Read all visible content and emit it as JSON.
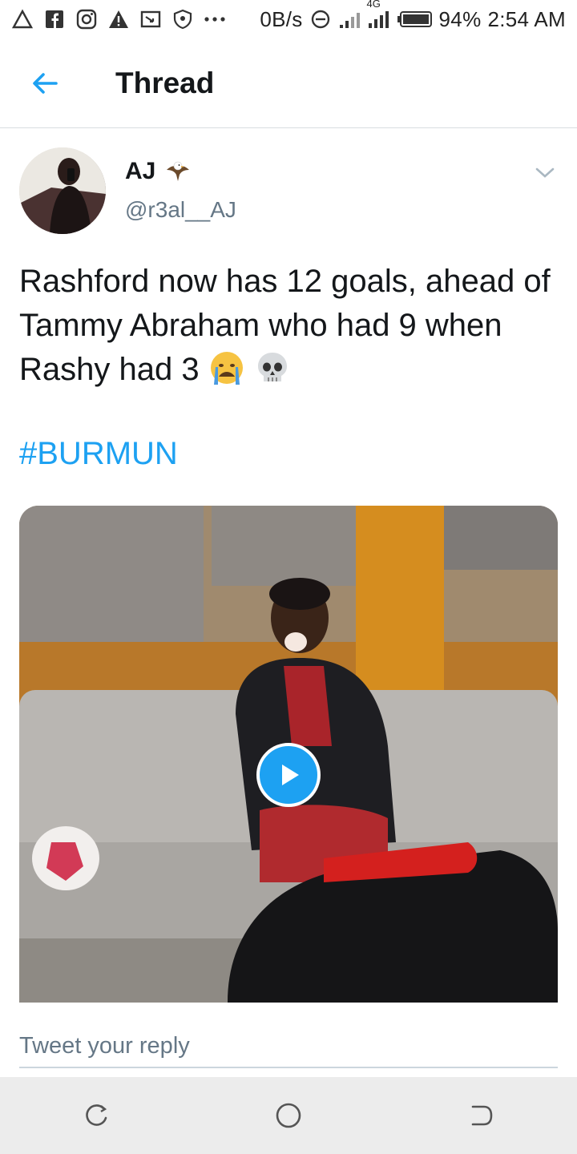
{
  "status_bar": {
    "net_speed": "0B/s",
    "network_type": "4G",
    "battery": "94%",
    "time": "2:54 AM",
    "left_icons": [
      "alert-icon",
      "facebook-icon",
      "instagram-icon",
      "warning-icon",
      "cast-icon",
      "shield-icon",
      "more-dots-icon"
    ]
  },
  "header": {
    "title": "Thread"
  },
  "tweet": {
    "author_name": "AJ",
    "author_handle": "@r3al__AJ",
    "text": "Rashford now has 12 goals, ahead of Tammy Abraham who had 9 when Rashy had 3",
    "emojis": [
      "crying-face-emoji",
      "skull-emoji"
    ],
    "hashtag": "#BURMUN",
    "media_type": "video"
  },
  "reply": {
    "placeholder": "Tweet your reply"
  },
  "colors": {
    "accent": "#1da1f2",
    "text_primary": "#14171a",
    "text_secondary": "#657786",
    "divider": "#d9dde0",
    "navbar_bg": "#ececec"
  }
}
